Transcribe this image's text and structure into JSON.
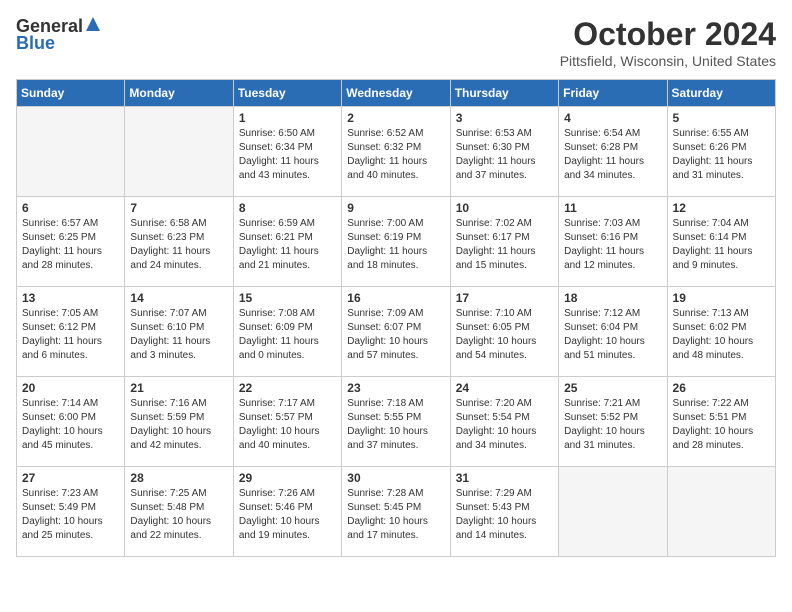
{
  "header": {
    "logo_general": "General",
    "logo_blue": "Blue",
    "month_title": "October 2024",
    "location": "Pittsfield, Wisconsin, United States"
  },
  "days_of_week": [
    "Sunday",
    "Monday",
    "Tuesday",
    "Wednesday",
    "Thursday",
    "Friday",
    "Saturday"
  ],
  "weeks": [
    [
      {
        "day": "",
        "empty": true
      },
      {
        "day": "",
        "empty": true
      },
      {
        "day": "1",
        "sunrise": "6:50 AM",
        "sunset": "6:34 PM",
        "daylight": "11 hours and 43 minutes."
      },
      {
        "day": "2",
        "sunrise": "6:52 AM",
        "sunset": "6:32 PM",
        "daylight": "11 hours and 40 minutes."
      },
      {
        "day": "3",
        "sunrise": "6:53 AM",
        "sunset": "6:30 PM",
        "daylight": "11 hours and 37 minutes."
      },
      {
        "day": "4",
        "sunrise": "6:54 AM",
        "sunset": "6:28 PM",
        "daylight": "11 hours and 34 minutes."
      },
      {
        "day": "5",
        "sunrise": "6:55 AM",
        "sunset": "6:26 PM",
        "daylight": "11 hours and 31 minutes."
      }
    ],
    [
      {
        "day": "6",
        "sunrise": "6:57 AM",
        "sunset": "6:25 PM",
        "daylight": "11 hours and 28 minutes."
      },
      {
        "day": "7",
        "sunrise": "6:58 AM",
        "sunset": "6:23 PM",
        "daylight": "11 hours and 24 minutes."
      },
      {
        "day": "8",
        "sunrise": "6:59 AM",
        "sunset": "6:21 PM",
        "daylight": "11 hours and 21 minutes."
      },
      {
        "day": "9",
        "sunrise": "7:00 AM",
        "sunset": "6:19 PM",
        "daylight": "11 hours and 18 minutes."
      },
      {
        "day": "10",
        "sunrise": "7:02 AM",
        "sunset": "6:17 PM",
        "daylight": "11 hours and 15 minutes."
      },
      {
        "day": "11",
        "sunrise": "7:03 AM",
        "sunset": "6:16 PM",
        "daylight": "11 hours and 12 minutes."
      },
      {
        "day": "12",
        "sunrise": "7:04 AM",
        "sunset": "6:14 PM",
        "daylight": "11 hours and 9 minutes."
      }
    ],
    [
      {
        "day": "13",
        "sunrise": "7:05 AM",
        "sunset": "6:12 PM",
        "daylight": "11 hours and 6 minutes."
      },
      {
        "day": "14",
        "sunrise": "7:07 AM",
        "sunset": "6:10 PM",
        "daylight": "11 hours and 3 minutes."
      },
      {
        "day": "15",
        "sunrise": "7:08 AM",
        "sunset": "6:09 PM",
        "daylight": "11 hours and 0 minutes."
      },
      {
        "day": "16",
        "sunrise": "7:09 AM",
        "sunset": "6:07 PM",
        "daylight": "10 hours and 57 minutes."
      },
      {
        "day": "17",
        "sunrise": "7:10 AM",
        "sunset": "6:05 PM",
        "daylight": "10 hours and 54 minutes."
      },
      {
        "day": "18",
        "sunrise": "7:12 AM",
        "sunset": "6:04 PM",
        "daylight": "10 hours and 51 minutes."
      },
      {
        "day": "19",
        "sunrise": "7:13 AM",
        "sunset": "6:02 PM",
        "daylight": "10 hours and 48 minutes."
      }
    ],
    [
      {
        "day": "20",
        "sunrise": "7:14 AM",
        "sunset": "6:00 PM",
        "daylight": "10 hours and 45 minutes."
      },
      {
        "day": "21",
        "sunrise": "7:16 AM",
        "sunset": "5:59 PM",
        "daylight": "10 hours and 42 minutes."
      },
      {
        "day": "22",
        "sunrise": "7:17 AM",
        "sunset": "5:57 PM",
        "daylight": "10 hours and 40 minutes."
      },
      {
        "day": "23",
        "sunrise": "7:18 AM",
        "sunset": "5:55 PM",
        "daylight": "10 hours and 37 minutes."
      },
      {
        "day": "24",
        "sunrise": "7:20 AM",
        "sunset": "5:54 PM",
        "daylight": "10 hours and 34 minutes."
      },
      {
        "day": "25",
        "sunrise": "7:21 AM",
        "sunset": "5:52 PM",
        "daylight": "10 hours and 31 minutes."
      },
      {
        "day": "26",
        "sunrise": "7:22 AM",
        "sunset": "5:51 PM",
        "daylight": "10 hours and 28 minutes."
      }
    ],
    [
      {
        "day": "27",
        "sunrise": "7:23 AM",
        "sunset": "5:49 PM",
        "daylight": "10 hours and 25 minutes."
      },
      {
        "day": "28",
        "sunrise": "7:25 AM",
        "sunset": "5:48 PM",
        "daylight": "10 hours and 22 minutes."
      },
      {
        "day": "29",
        "sunrise": "7:26 AM",
        "sunset": "5:46 PM",
        "daylight": "10 hours and 19 minutes."
      },
      {
        "day": "30",
        "sunrise": "7:28 AM",
        "sunset": "5:45 PM",
        "daylight": "10 hours and 17 minutes."
      },
      {
        "day": "31",
        "sunrise": "7:29 AM",
        "sunset": "5:43 PM",
        "daylight": "10 hours and 14 minutes."
      },
      {
        "day": "",
        "empty": true
      },
      {
        "day": "",
        "empty": true
      }
    ]
  ]
}
